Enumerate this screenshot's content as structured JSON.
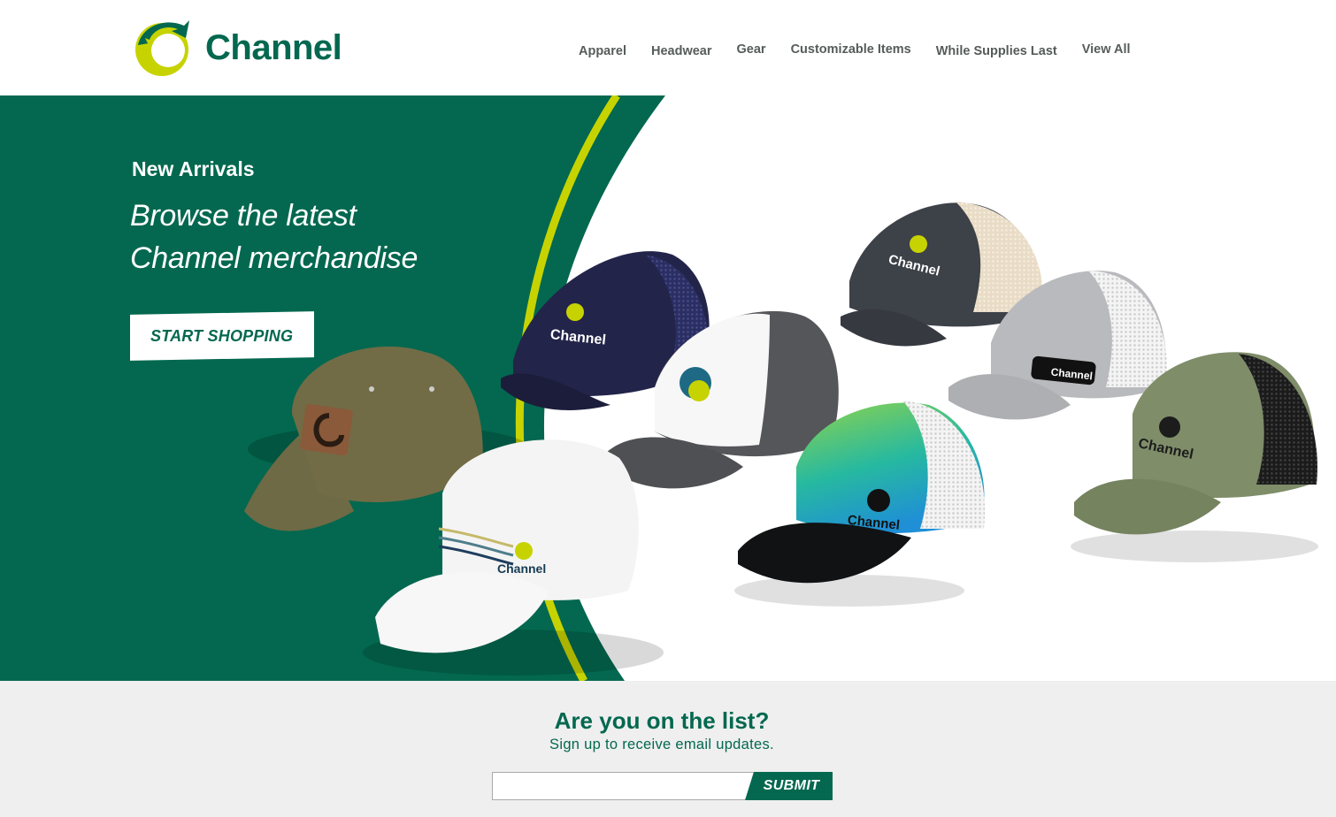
{
  "brand": {
    "name": "Channel",
    "logo_icon": "channel-c-logo-icon",
    "colors": {
      "primary_green": "#03684f",
      "accent_lime": "#c7d300",
      "text_gray": "#555c5a",
      "footer_bg": "#efefef"
    }
  },
  "nav": {
    "items": [
      {
        "label": "Apparel"
      },
      {
        "label": "Headwear"
      },
      {
        "label": "Gear"
      },
      {
        "label": "Customizable Items"
      },
      {
        "label": "While Supplies Last"
      },
      {
        "label": "View All"
      }
    ]
  },
  "hero": {
    "heading": "New Arrivals",
    "tagline_line1": "Browse the latest",
    "tagline_line2": "Channel merchandise",
    "cta_label": "START SHOPPING",
    "hat_logo_text": "Channel"
  },
  "newsletter": {
    "title": "Are you on the list?",
    "subtitle": "Sign up to receive email updates.",
    "email_value": "",
    "submit_label": "SUBMIT"
  }
}
